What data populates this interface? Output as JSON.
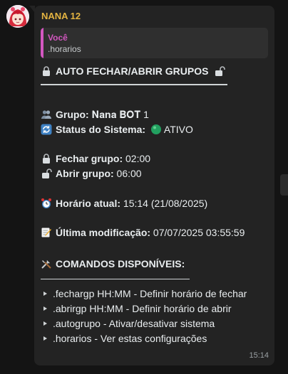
{
  "chat": {
    "sender": "NANA 12",
    "quote": {
      "author": "Você",
      "text": ".horarios"
    },
    "title": "AUTO FECHAR/ABRIR GRUPOS",
    "group_label": "Grupo:",
    "group_value": "𝐍𝐚𝐧𝐚 𝐁𝐎𝐓 1",
    "status_label": "Status do Sistema:",
    "status_value": "ATIVO",
    "close_label": "Fechar grupo:",
    "close_value": "02:00",
    "open_label": "Abrir grupo:",
    "open_value": "06:00",
    "now_label": "Horário atual:",
    "now_value": "15:14 (21/08/2025)",
    "modified_label": "Última modificação:",
    "modified_value": "07/07/2025 03:55:59",
    "commands_title": "COMANDOS DISPONÍVEIS:",
    "commands": [
      ".fechargp HH:MM - Definir horário de fechar",
      ".abrirgp HH:MM - Definir horário de abrir",
      ".autogrupo - Ativar/desativar sistema",
      ".horarios - Ver estas configurações"
    ],
    "time": "15:14",
    "colors": {
      "sender": "#e3b341",
      "quote_accent": "#d357c0",
      "status_dot": "#22a060"
    }
  }
}
